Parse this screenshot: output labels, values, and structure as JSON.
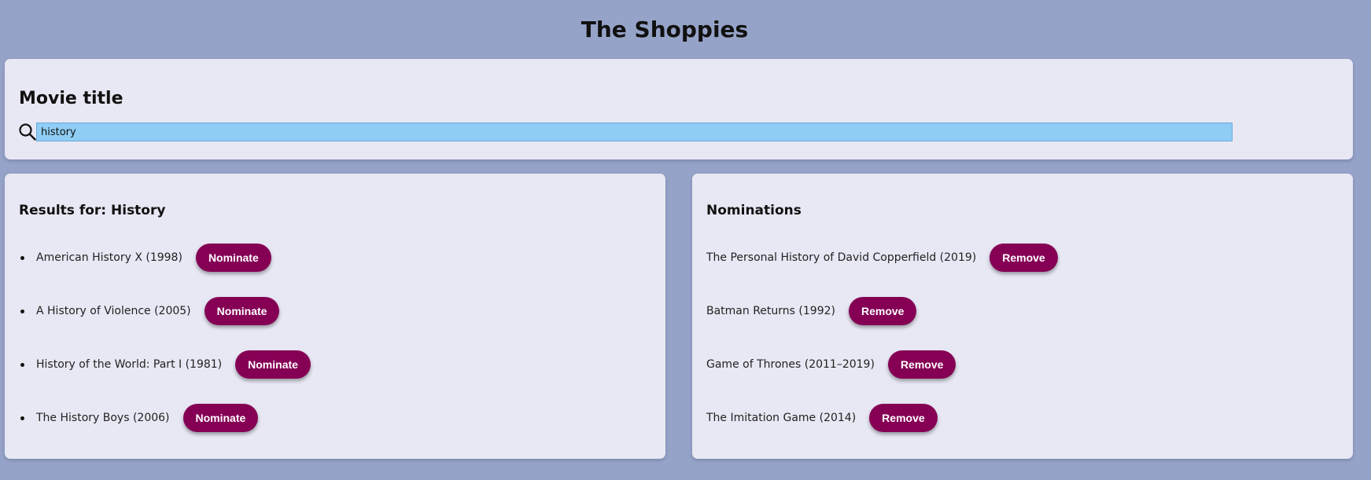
{
  "app": {
    "title": "The Shoppies"
  },
  "search": {
    "heading": "Movie title",
    "value": "history",
    "icon": "search-icon"
  },
  "results": {
    "heading": "Results for: History",
    "button_label": "Nominate",
    "items": [
      {
        "title": "American History X (1998)",
        "button": "Nominate"
      },
      {
        "title": "A History of Violence (2005)",
        "button": "Nominate"
      },
      {
        "title": "History of the World: Part I (1981)",
        "button": "Nominate"
      },
      {
        "title": "The History Boys (2006)",
        "button": "Nominate"
      }
    ]
  },
  "nominations": {
    "heading": "Nominations",
    "button_label": "Remove",
    "items": [
      {
        "title": "The Personal History of David Copperfield (2019)",
        "button": "Remove"
      },
      {
        "title": "Batman Returns (1992)",
        "button": "Remove"
      },
      {
        "title": "Game of Thrones (2011–2019)",
        "button": "Remove"
      },
      {
        "title": "The Imitation Game (2014)",
        "button": "Remove"
      }
    ]
  },
  "colors": {
    "background": "#96a3c8",
    "card": "#e8e8f4",
    "button": "#850055",
    "input_highlight": "#8fcdf4"
  }
}
